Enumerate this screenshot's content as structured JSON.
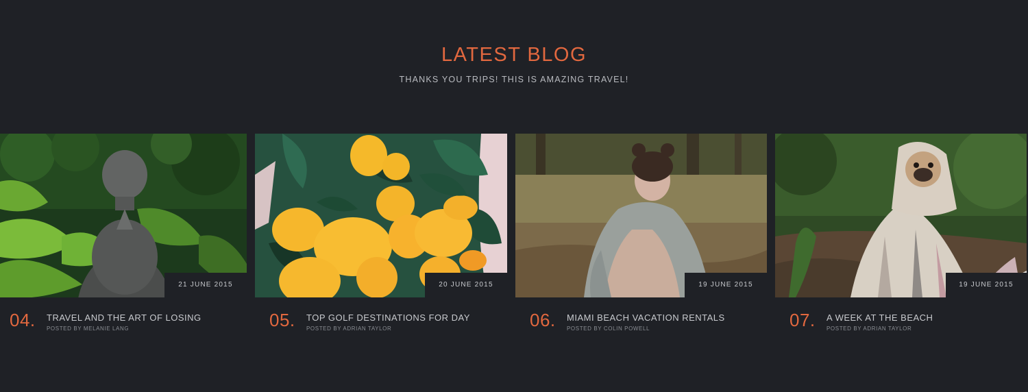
{
  "section": {
    "title": "LATEST BLOG",
    "subtitle": "THANKS YOU TRIPS! THIS IS AMAZING TRAVEL!"
  },
  "posts": [
    {
      "number": "04.",
      "title": "TRAVEL AND THE ART OF LOSING",
      "author": "POSTED BY MELANIE LANG",
      "date": "21 JUNE 2015",
      "image": "buddha-statue-among-leaves-image"
    },
    {
      "number": "05.",
      "title": "TOP GOLF DESTINATIONS FOR DAY",
      "author": "POSTED BY ADRIAN TAYLOR",
      "date": "20 JUNE 2015",
      "image": "lemons-on-tree-image"
    },
    {
      "number": "06.",
      "title": "MIAMI BEACH VACATION RENTALS",
      "author": "POSTED BY COLIN POWELL",
      "date": "19 JUNE 2015",
      "image": "girl-sitting-in-field-image"
    },
    {
      "number": "07.",
      "title": "A WEEK AT THE BEACH",
      "author": "POSTED BY ADRIAN TAYLOR",
      "date": "19 JUNE 2015",
      "image": "pug-in-blanket-image"
    }
  ],
  "colors": {
    "background": "#1f2126",
    "accent": "#e2683f",
    "text": "#c9cbcf",
    "muted": "#8a8d93"
  }
}
